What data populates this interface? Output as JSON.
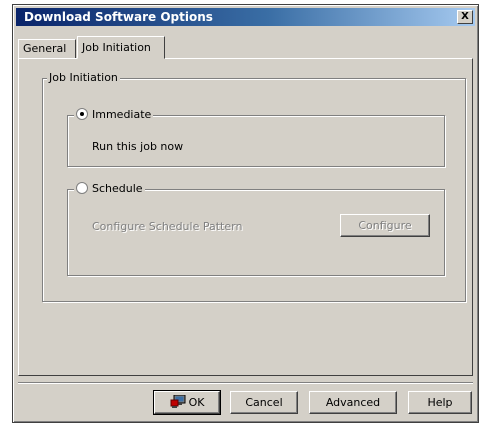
{
  "window": {
    "title": "Download Software Options",
    "close_label": "X"
  },
  "tabs": [
    {
      "label": "General"
    },
    {
      "label": "Job Initiation"
    }
  ],
  "job_initiation": {
    "group_title": "Job Initiation",
    "immediate": {
      "label": "Immediate",
      "selected": true,
      "description": "Run this job now"
    },
    "schedule": {
      "label": "Schedule",
      "selected": false,
      "description": "Configure Schedule Pattern",
      "configure_label": "Configure"
    }
  },
  "buttons": {
    "ok": "OK",
    "cancel": "Cancel",
    "advanced": "Advanced",
    "help": "Help"
  },
  "icons": {
    "ok": "computer-network-icon"
  }
}
